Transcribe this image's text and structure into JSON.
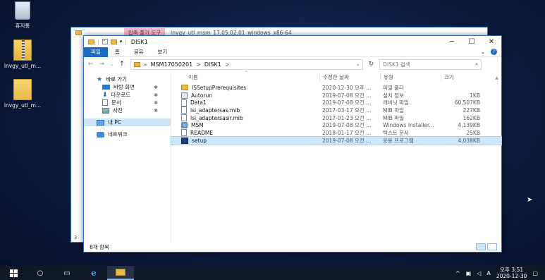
{
  "desktop": {
    "icons": [
      {
        "label": "휴지통"
      },
      {
        "label": "lnvgy_utl_m..."
      },
      {
        "label": "lnvgy_utl_m..."
      }
    ]
  },
  "back_window": {
    "tool_tab": "압축 풀기 도구",
    "title": "lnvgy_utl_msm_17.05.02.01_windows_x86-64",
    "status": "3"
  },
  "window": {
    "title": "DISK1",
    "ribbon_tabs": [
      "파일",
      "홈",
      "공유",
      "보기"
    ],
    "address": {
      "segments": [
        "MSM17050201",
        "DISK1"
      ],
      "separator": ">"
    },
    "search_placeholder": "DISK1 검색",
    "nav": {
      "quick_access": "바로 가기",
      "items": [
        "바탕 화면",
        "다운로드",
        "문서",
        "사진"
      ],
      "this_pc": "내 PC",
      "network": "네트워크"
    },
    "columns": {
      "name": "이름",
      "date": "수정한 날짜",
      "type": "유형",
      "size": "크기"
    },
    "files": [
      {
        "name": "ISSetupPrerequisites",
        "date": "2020-12-30 오후 ...",
        "type": "파일 폴더",
        "size": "",
        "icon": "folder-icon"
      },
      {
        "name": "Autorun",
        "date": "2019-07-08 오전 ...",
        "type": "설치 정보",
        "size": "1KB",
        "icon": "autorun-icon"
      },
      {
        "name": "Data1",
        "date": "2019-07-08 오전 ...",
        "type": "캐비닛 파일",
        "size": "60,507KB",
        "icon": "file-icon"
      },
      {
        "name": "lsi_adaptersas.mib",
        "date": "2017-03-17 오전 ...",
        "type": "MIB 파일",
        "size": "227KB",
        "icon": "file-icon"
      },
      {
        "name": "lsi_adaptersasir.mib",
        "date": "2017-01-23 오전 ...",
        "type": "MIB 파일",
        "size": "162KB",
        "icon": "file-icon"
      },
      {
        "name": "MSM",
        "date": "2019-07-08 오전 ...",
        "type": "Windows Installer...",
        "size": "4,139KB",
        "icon": "installer-icon"
      },
      {
        "name": "README",
        "date": "2018-01-17 오전 ...",
        "type": "텍스트 문서",
        "size": "25KB",
        "icon": "file-icon"
      },
      {
        "name": "setup",
        "date": "2019-07-08 오전 ...",
        "type": "응용 프로그램",
        "size": "4,038KB",
        "icon": "exe-icon"
      }
    ],
    "status": "8개 항목"
  },
  "taskbar": {
    "tray_lang": "A",
    "time": "오후 3:51",
    "date": "2020-12-30"
  }
}
